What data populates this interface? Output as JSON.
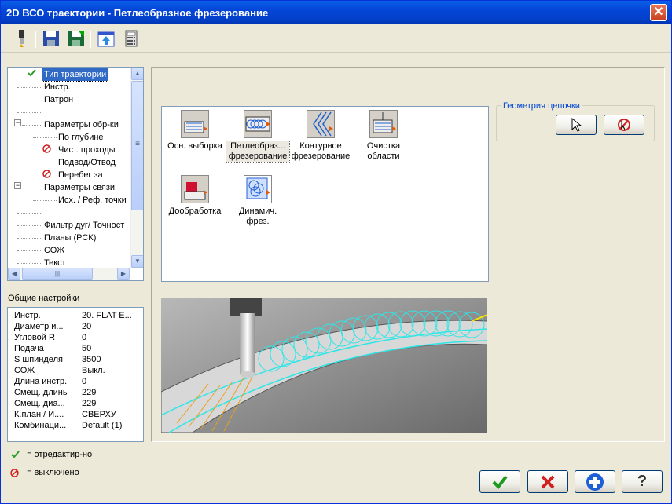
{
  "window": {
    "title": "2D ВСО траектории - Петлеобразное фрезерование"
  },
  "toolbar": {
    "buttons": [
      "tool-icon",
      "save-icon",
      "save-as-icon",
      "export-icon",
      "calculator-icon"
    ]
  },
  "tree": {
    "items": [
      {
        "label": "Тип траектории",
        "state": "edited",
        "selected": true,
        "level": 1
      },
      {
        "label": "Инстр.",
        "level": 1
      },
      {
        "label": "Патрон",
        "level": 1
      },
      {
        "label": "",
        "level": 1
      },
      {
        "label": "Параметры обр-ки",
        "level": 1,
        "expandable": true
      },
      {
        "label": "По глубине",
        "level": 2
      },
      {
        "label": "Чист. проходы",
        "state": "disabled",
        "level": 2
      },
      {
        "label": "Подвод/Отвод",
        "level": 2
      },
      {
        "label": "Перебег за",
        "state": "disabled",
        "level": 2
      },
      {
        "label": "Параметры связи",
        "level": 1,
        "expandable": true
      },
      {
        "label": "Исх. / Реф. точки",
        "level": 2
      },
      {
        "label": "",
        "level": 1
      },
      {
        "label": "Фильтр дуг/ Точност",
        "level": 1
      },
      {
        "label": "Планы (РСК)",
        "level": 1
      },
      {
        "label": "СОЖ",
        "level": 1
      },
      {
        "label": "Текст",
        "level": 1
      }
    ]
  },
  "general": {
    "title": "Общие настройки",
    "rows": [
      {
        "k": "Инстр.",
        "v": "20. FLAT E..."
      },
      {
        "k": "Диаметр и...",
        "v": "20"
      },
      {
        "k": "Угловой R",
        "v": "0"
      },
      {
        "k": "Подача",
        "v": "50"
      },
      {
        "k": "S шпинделя",
        "v": "3500"
      },
      {
        "k": "СОЖ",
        "v": "Выкл."
      },
      {
        "k": "Длина инстр.",
        "v": "0"
      },
      {
        "k": "Смещ. длины",
        "v": "229"
      },
      {
        "k": "Смещ. диа...",
        "v": "229"
      },
      {
        "k": "К.план / И....",
        "v": "СВЕРХУ"
      },
      {
        "k": "Комбинаци...",
        "v": "Default (1)"
      }
    ]
  },
  "legend": {
    "edited": "= отредактир-но",
    "disabled": "= выключено"
  },
  "toolpaths": [
    {
      "label": "Осн. выборка",
      "selected": false
    },
    {
      "label": "Петлеобраз... фрезерование",
      "selected": true
    },
    {
      "label": "Контурное фрезерование",
      "selected": false
    },
    {
      "label": "Очистка области",
      "selected": false
    },
    {
      "label": "Дообработка",
      "selected": false
    },
    {
      "label": "Динамич. фрез.",
      "selected": false
    }
  ],
  "chain_geometry": {
    "title": "Геометрия цепочки"
  },
  "colors": {
    "accent": "#0046d5",
    "titlebar": "#0446d8",
    "toolpath": "#2ee6e6"
  }
}
